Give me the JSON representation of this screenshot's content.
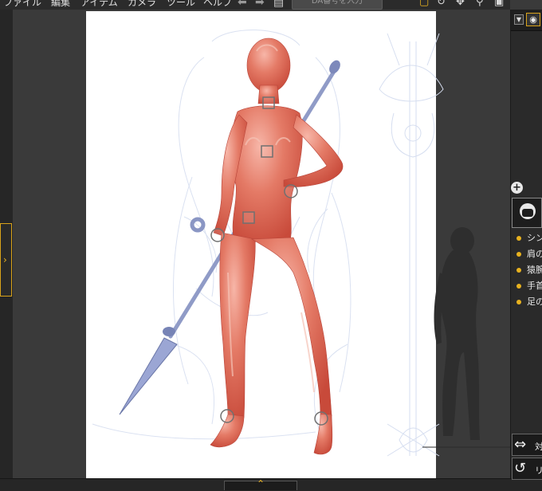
{
  "menu": {
    "items": [
      "ファイル",
      "編集",
      "アイテム",
      "カメラ",
      "ツール",
      "ヘルプ"
    ]
  },
  "search": {
    "placeholder": "DA番号を入力"
  },
  "toolbar": {
    "icons": [
      "select-icon",
      "rotate-icon",
      "move-icon",
      "zoom-icon",
      "camera-icon"
    ]
  },
  "right_panel": {
    "list_items": [
      "シン",
      "肩の",
      "猿腕",
      "手首",
      "足の"
    ],
    "buttons": [
      {
        "icon": "swap-icon",
        "label": "対"
      },
      {
        "icon": "reset-icon",
        "label": "リ"
      }
    ]
  },
  "colors": {
    "accent": "#e8b21f",
    "figure": "#e26a56",
    "spear": "#8a96c4",
    "background": "#3a3a3a",
    "panel": "#2a2a2a"
  }
}
